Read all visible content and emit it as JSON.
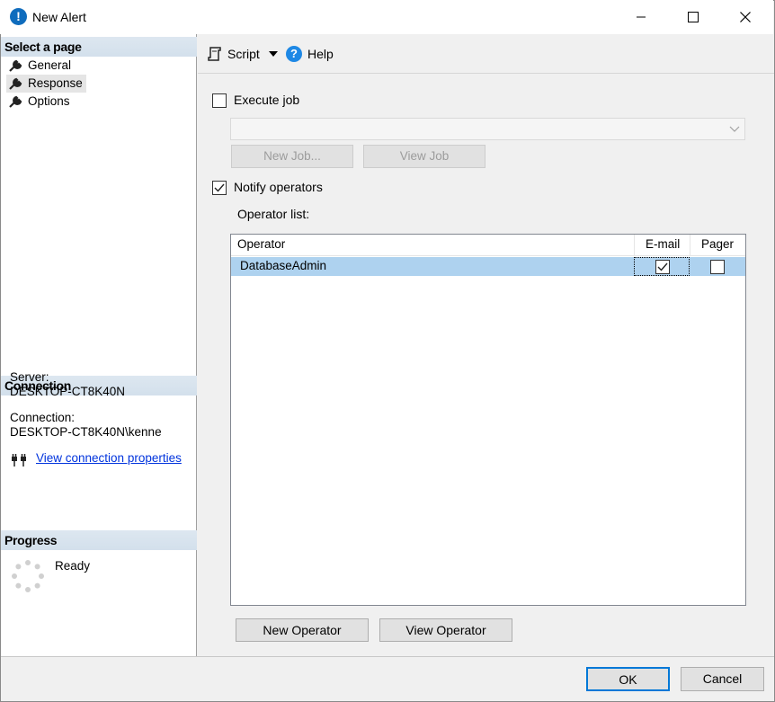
{
  "window": {
    "title": "New Alert"
  },
  "left_panel": {
    "select_page_header": "Select a page",
    "pages": [
      {
        "label": "General"
      },
      {
        "label": "Response"
      },
      {
        "label": "Options"
      }
    ],
    "selected_page": "Response",
    "connection_header": "Connection",
    "server_label": "Server:",
    "server_value": "DESKTOP-CT8K40N",
    "connection_label": "Connection:",
    "connection_value": "DESKTOP-CT8K40N\\kenne",
    "view_connection_link": "View connection properties",
    "progress_header": "Progress",
    "progress_status": "Ready"
  },
  "toolbar": {
    "script_label": "Script",
    "help_label": "Help"
  },
  "response": {
    "execute_job_label": "Execute job",
    "execute_job_checked": false,
    "job_select_value": "",
    "new_job_label": "New Job...",
    "view_job_label": "View Job",
    "notify_operators_label": "Notify operators",
    "notify_operators_checked": true,
    "operator_list_label": "Operator list:",
    "columns": [
      "Operator",
      "E-mail",
      "Pager"
    ],
    "operators": [
      {
        "name": "DatabaseAdmin",
        "email": true,
        "pager": false
      }
    ],
    "new_operator_label": "New Operator",
    "view_operator_label": "View Operator"
  },
  "footer": {
    "ok_label": "OK",
    "cancel_label": "Cancel"
  },
  "colors": {
    "selection_row": "#aed2ef",
    "section_header": "#d8e3ee",
    "link": "#0033dd",
    "ok_border": "#0078d7"
  }
}
